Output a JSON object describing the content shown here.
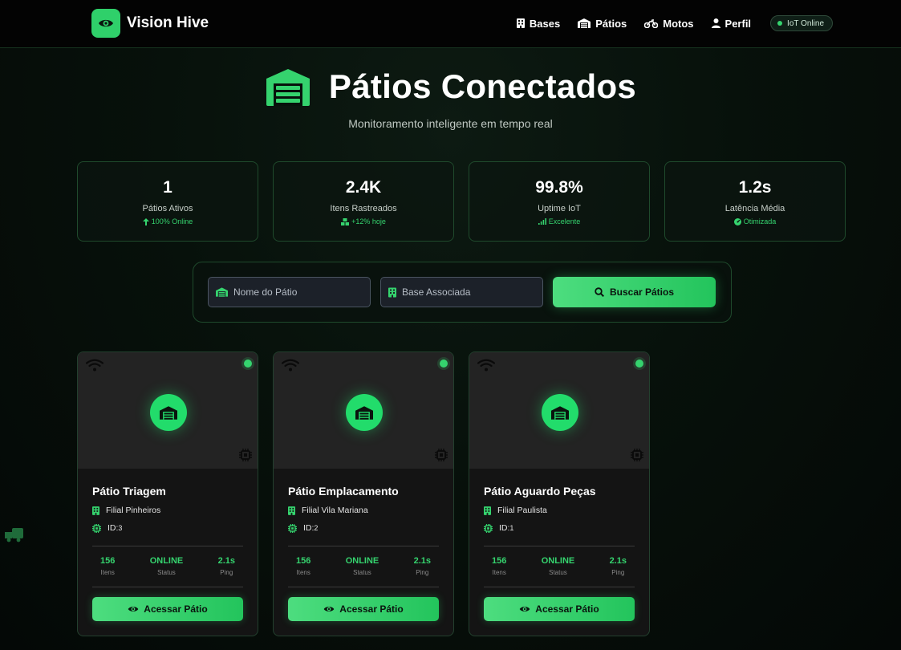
{
  "brand": {
    "name": "Vision Hive",
    "icon": "eye-icon"
  },
  "nav": {
    "items": [
      {
        "label": "Bases",
        "icon": "building-icon"
      },
      {
        "label": "Pátios",
        "icon": "warehouse-icon"
      },
      {
        "label": "Motos",
        "icon": "motorcycle-icon"
      },
      {
        "label": "Perfil",
        "icon": "user-icon"
      }
    ],
    "status": "IoT Online"
  },
  "hero": {
    "title": "Pátios Conectados",
    "subtitle": "Monitoramento inteligente em tempo real",
    "icon": "warehouse-icon"
  },
  "stats": [
    {
      "value": "1",
      "label": "Pátios Ativos",
      "note": "100% Online",
      "icon": "arrow-up-icon"
    },
    {
      "value": "2.4K",
      "label": "Itens Rastreados",
      "note": "+12% hoje",
      "icon": "boxes-icon"
    },
    {
      "value": "99.8%",
      "label": "Uptime IoT",
      "note": "Excelente",
      "icon": "signal-icon"
    },
    {
      "value": "1.2s",
      "label": "Latência Média",
      "note": "Otimizada",
      "icon": "gauge-icon"
    }
  ],
  "search": {
    "name_placeholder": "Nome do Pátio",
    "base_placeholder": "Base Associada",
    "button_label": "Buscar Pátios"
  },
  "cards": [
    {
      "title": "Pátio Triagem",
      "base": "Filial Pinheiros",
      "id_label": "ID:",
      "id_value": "3",
      "metrics": [
        {
          "value": "156",
          "label": "Itens"
        },
        {
          "value": "ONLINE",
          "label": "Status"
        },
        {
          "value": "2.1s",
          "label": "Ping"
        }
      ],
      "button": "Acessar Pátio"
    },
    {
      "title": "Pátio Emplacamento",
      "base": "Filial Vila Mariana",
      "id_label": "ID:",
      "id_value": "2",
      "metrics": [
        {
          "value": "156",
          "label": "Itens"
        },
        {
          "value": "ONLINE",
          "label": "Status"
        },
        {
          "value": "2.1s",
          "label": "Ping"
        }
      ],
      "button": "Acessar Pátio"
    },
    {
      "title": "Pátio Aguardo Peças",
      "base": "Filial Paulista",
      "id_label": "ID:",
      "id_value": "1",
      "metrics": [
        {
          "value": "156",
          "label": "Itens"
        },
        {
          "value": "ONLINE",
          "label": "Status"
        },
        {
          "value": "2.1s",
          "label": "Ping"
        }
      ],
      "button": "Acessar Pátio"
    }
  ],
  "colors": {
    "accent": "#35d36e",
    "background": "#07110b",
    "card": "#141414"
  }
}
